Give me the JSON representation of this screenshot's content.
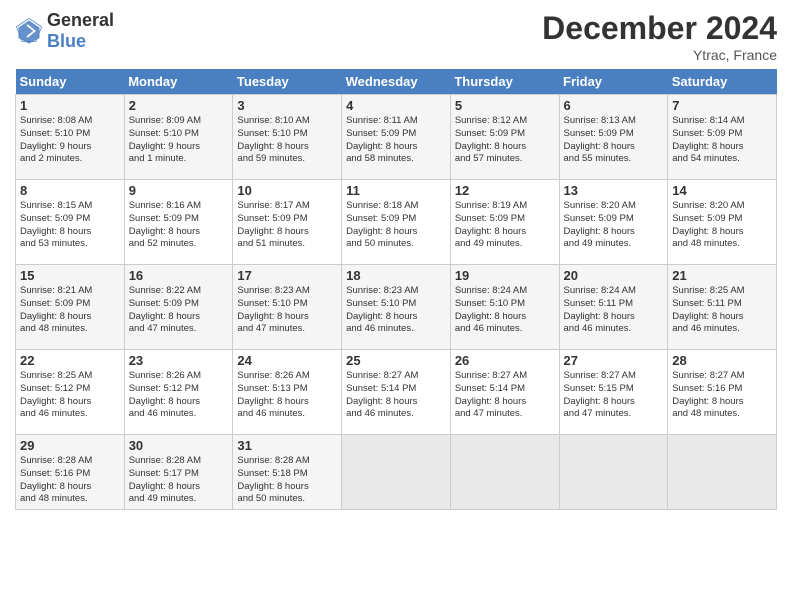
{
  "header": {
    "logo_general": "General",
    "logo_blue": "Blue",
    "title": "December 2024",
    "location": "Ytrac, France"
  },
  "days_of_week": [
    "Sunday",
    "Monday",
    "Tuesday",
    "Wednesday",
    "Thursday",
    "Friday",
    "Saturday"
  ],
  "weeks": [
    [
      {
        "day": 1,
        "sunrise": "8:08 AM",
        "sunset": "5:10 PM",
        "daylight": "9 hours and 2 minutes."
      },
      {
        "day": 2,
        "sunrise": "8:09 AM",
        "sunset": "5:10 PM",
        "daylight": "9 hours and 1 minute."
      },
      {
        "day": 3,
        "sunrise": "8:10 AM",
        "sunset": "5:10 PM",
        "daylight": "8 hours and 59 minutes."
      },
      {
        "day": 4,
        "sunrise": "8:11 AM",
        "sunset": "5:09 PM",
        "daylight": "8 hours and 58 minutes."
      },
      {
        "day": 5,
        "sunrise": "8:12 AM",
        "sunset": "5:09 PM",
        "daylight": "8 hours and 57 minutes."
      },
      {
        "day": 6,
        "sunrise": "8:13 AM",
        "sunset": "5:09 PM",
        "daylight": "8 hours and 55 minutes."
      },
      {
        "day": 7,
        "sunrise": "8:14 AM",
        "sunset": "5:09 PM",
        "daylight": "8 hours and 54 minutes."
      }
    ],
    [
      {
        "day": 8,
        "sunrise": "8:15 AM",
        "sunset": "5:09 PM",
        "daylight": "8 hours and 53 minutes."
      },
      {
        "day": 9,
        "sunrise": "8:16 AM",
        "sunset": "5:09 PM",
        "daylight": "8 hours and 52 minutes."
      },
      {
        "day": 10,
        "sunrise": "8:17 AM",
        "sunset": "5:09 PM",
        "daylight": "8 hours and 51 minutes."
      },
      {
        "day": 11,
        "sunrise": "8:18 AM",
        "sunset": "5:09 PM",
        "daylight": "8 hours and 50 minutes."
      },
      {
        "day": 12,
        "sunrise": "8:19 AM",
        "sunset": "5:09 PM",
        "daylight": "8 hours and 49 minutes."
      },
      {
        "day": 13,
        "sunrise": "8:20 AM",
        "sunset": "5:09 PM",
        "daylight": "8 hours and 49 minutes."
      },
      {
        "day": 14,
        "sunrise": "8:20 AM",
        "sunset": "5:09 PM",
        "daylight": "8 hours and 48 minutes."
      }
    ],
    [
      {
        "day": 15,
        "sunrise": "8:21 AM",
        "sunset": "5:09 PM",
        "daylight": "8 hours and 48 minutes."
      },
      {
        "day": 16,
        "sunrise": "8:22 AM",
        "sunset": "5:09 PM",
        "daylight": "8 hours and 47 minutes."
      },
      {
        "day": 17,
        "sunrise": "8:23 AM",
        "sunset": "5:10 PM",
        "daylight": "8 hours and 47 minutes."
      },
      {
        "day": 18,
        "sunrise": "8:23 AM",
        "sunset": "5:10 PM",
        "daylight": "8 hours and 46 minutes."
      },
      {
        "day": 19,
        "sunrise": "8:24 AM",
        "sunset": "5:10 PM",
        "daylight": "8 hours and 46 minutes."
      },
      {
        "day": 20,
        "sunrise": "8:24 AM",
        "sunset": "5:11 PM",
        "daylight": "8 hours and 46 minutes."
      },
      {
        "day": 21,
        "sunrise": "8:25 AM",
        "sunset": "5:11 PM",
        "daylight": "8 hours and 46 minutes."
      }
    ],
    [
      {
        "day": 22,
        "sunrise": "8:25 AM",
        "sunset": "5:12 PM",
        "daylight": "8 hours and 46 minutes."
      },
      {
        "day": 23,
        "sunrise": "8:26 AM",
        "sunset": "5:12 PM",
        "daylight": "8 hours and 46 minutes."
      },
      {
        "day": 24,
        "sunrise": "8:26 AM",
        "sunset": "5:13 PM",
        "daylight": "8 hours and 46 minutes."
      },
      {
        "day": 25,
        "sunrise": "8:27 AM",
        "sunset": "5:14 PM",
        "daylight": "8 hours and 46 minutes."
      },
      {
        "day": 26,
        "sunrise": "8:27 AM",
        "sunset": "5:14 PM",
        "daylight": "8 hours and 47 minutes."
      },
      {
        "day": 27,
        "sunrise": "8:27 AM",
        "sunset": "5:15 PM",
        "daylight": "8 hours and 47 minutes."
      },
      {
        "day": 28,
        "sunrise": "8:27 AM",
        "sunset": "5:16 PM",
        "daylight": "8 hours and 48 minutes."
      }
    ],
    [
      {
        "day": 29,
        "sunrise": "8:28 AM",
        "sunset": "5:16 PM",
        "daylight": "8 hours and 48 minutes."
      },
      {
        "day": 30,
        "sunrise": "8:28 AM",
        "sunset": "5:17 PM",
        "daylight": "8 hours and 49 minutes."
      },
      {
        "day": 31,
        "sunrise": "8:28 AM",
        "sunset": "5:18 PM",
        "daylight": "8 hours and 50 minutes."
      },
      null,
      null,
      null,
      null
    ]
  ]
}
